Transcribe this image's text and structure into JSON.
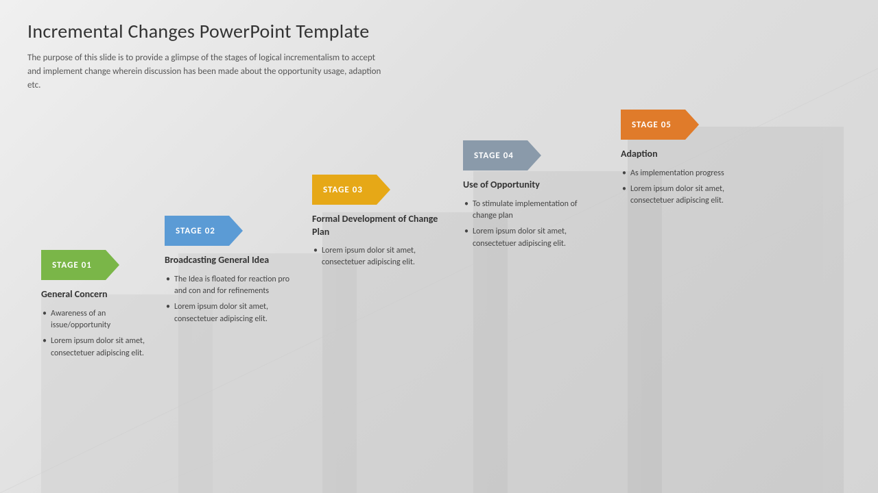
{
  "title": "Incremental Changes PowerPoint Template",
  "description": "The purpose of this slide is to provide a glimpse of the stages of logical incrementalism to accept and implement change wherein discussion has been made about the opportunity usage, adaption etc.",
  "stages": [
    {
      "id": "stage01",
      "label": "STAGE 01",
      "color": "green",
      "title": "General Concern",
      "bullets": [
        "Awareness of an issue/opportunity",
        "Lorem ipsum dolor sit amet, consectetuer adipiscing elit."
      ]
    },
    {
      "id": "stage02",
      "label": "STAGE 02",
      "color": "blue",
      "title": "Broadcasting General Idea",
      "bullets": [
        "The Idea is floated for reaction pro and con and for refinements",
        "Lorem ipsum dolor sit amet, consectetuer adipiscing elit."
      ]
    },
    {
      "id": "stage03",
      "label": "STAGE 03",
      "color": "yellow",
      "title": "Formal Development of Change Plan",
      "bullets": [
        "Lorem ipsum dolor sit amet, consectetuer adipiscing elit."
      ]
    },
    {
      "id": "stage04",
      "label": "STAGE 04",
      "color": "gray",
      "title": "Use of Opportunity",
      "bullets": [
        "To stimulate implementation of change plan",
        "Lorem ipsum dolor sit amet, consectetuer adipiscing elit."
      ]
    },
    {
      "id": "stage05",
      "label": "STAGE 05",
      "color": "orange",
      "title": "Adaption",
      "bullets": [
        "As implementation progress",
        "Lorem ipsum dolor sit amet, consectetuer adipiscing elit."
      ]
    }
  ]
}
